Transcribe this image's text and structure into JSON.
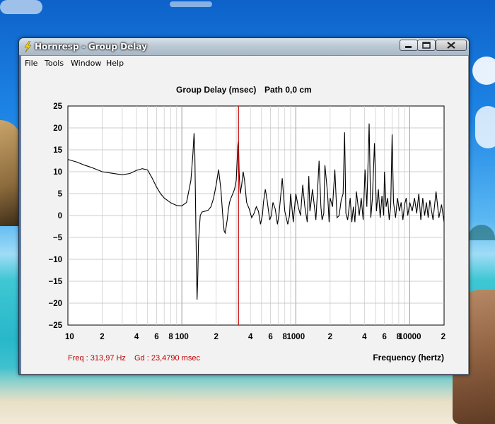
{
  "window": {
    "title": "Hornresp - Group Delay",
    "buttons": [
      "minimize",
      "maximize",
      "close"
    ]
  },
  "menu": {
    "file": "File",
    "tools": "Tools",
    "window": "Window",
    "help": "Help"
  },
  "colors": {
    "trace": "#000000",
    "cursor": "#c00000",
    "grid": "#bdbdbd",
    "background": "#ffffff"
  },
  "chart_data": {
    "type": "line",
    "title_left": "Group Delay (msec)",
    "title_right": "Path 0,0 cm",
    "xlabel": "Frequency (hertz)",
    "x_scale": "log",
    "xlim": [
      10,
      20000
    ],
    "ylim": [
      -25,
      25
    ],
    "grid": true,
    "y_ticks": [
      "25",
      "20",
      "15",
      "10",
      "5",
      "0",
      "−5",
      "−10",
      "−15",
      "−20",
      "−25"
    ],
    "x_tick_labels": [
      {
        "f": 10,
        "label": "10"
      },
      {
        "f": 20,
        "label": "2"
      },
      {
        "f": 40,
        "label": "4"
      },
      {
        "f": 60,
        "label": "6"
      },
      {
        "f": 80,
        "label": "8"
      },
      {
        "f": 100,
        "label": "100"
      },
      {
        "f": 200,
        "label": "2"
      },
      {
        "f": 400,
        "label": "4"
      },
      {
        "f": 600,
        "label": "6"
      },
      {
        "f": 800,
        "label": "8"
      },
      {
        "f": 1000,
        "label": "1000"
      },
      {
        "f": 2000,
        "label": "2"
      },
      {
        "f": 4000,
        "label": "4"
      },
      {
        "f": 6000,
        "label": "6"
      },
      {
        "f": 8000,
        "label": "8"
      },
      {
        "f": 10000,
        "label": "10000"
      },
      {
        "f": 20000,
        "label": "2"
      }
    ],
    "cursor": {
      "freq": 313.97,
      "gd": 23.479
    },
    "readout_freq": "Freq : 313,97 Hz",
    "readout_gd": "Gd : 23,4790 msec",
    "series": [
      {
        "x": [
          10,
          12,
          14,
          16,
          20,
          25,
          30,
          35,
          40,
          45,
          50,
          55,
          60,
          65,
          70,
          80,
          90,
          100,
          110,
          120,
          125,
          128,
          130,
          132,
          134,
          136,
          138,
          140,
          145,
          150,
          160,
          170,
          180,
          190,
          200,
          210,
          220,
          230,
          235,
          240,
          245,
          250,
          255,
          262,
          270,
          280,
          290,
          300,
          305,
          310,
          313.97,
          318,
          325,
          335,
          345,
          355,
          370,
          390,
          410,
          430,
          450,
          470,
          490,
          510,
          520,
          540,
          560,
          590,
          610,
          630,
          660,
          690,
          710,
          740,
          760,
          800,
          850,
          880,
          900,
          950,
          1000,
          1050,
          1100,
          1150,
          1200,
          1260,
          1300,
          1330,
          1360,
          1400,
          1500,
          1550,
          1600,
          1660,
          1700,
          1760,
          1800,
          1900,
          1960,
          2000,
          2100,
          2200,
          2300,
          2400,
          2500,
          2600,
          2680,
          2750,
          2850,
          3000,
          3100,
          3200,
          3300,
          3400,
          3600,
          3750,
          3900,
          4050,
          4200,
          4400,
          4550,
          4700,
          4900,
          5100,
          5300,
          5500,
          5700,
          5900,
          6000,
          6200,
          6400,
          6600,
          6800,
          7000,
          7200,
          7500,
          7800,
          8100,
          8400,
          8700,
          9000,
          9300,
          9600,
          10000,
          10500,
          11000,
          11500,
          12000,
          12500,
          13000,
          13500,
          14000,
          14500,
          15000,
          16000,
          17000,
          18000,
          19000,
          20000
        ],
        "y": [
          12.8,
          12.2,
          11.5,
          11,
          10,
          9.6,
          9.3,
          9.6,
          10.3,
          10.7,
          10.4,
          8.5,
          6.5,
          5,
          4,
          2.9,
          2.3,
          2.2,
          3,
          8,
          14,
          18.8,
          14,
          2,
          -10,
          -19.2,
          -14,
          -6,
          0,
          0.8,
          1,
          1.2,
          2,
          4,
          7,
          10.5,
          6,
          -1,
          -3.5,
          -4,
          -2.5,
          -1,
          1,
          3,
          4,
          5,
          6,
          8,
          12,
          16,
          17,
          10,
          5,
          7,
          10,
          8,
          3,
          1.5,
          -0.5,
          0.5,
          2,
          1,
          -2,
          0.2,
          3,
          6,
          3.5,
          -1,
          0,
          3,
          1.5,
          -2,
          0,
          5,
          8.5,
          1,
          -2,
          0,
          5,
          -1.5,
          5,
          2,
          0,
          7,
          2,
          -1.5,
          9,
          1,
          3,
          6,
          -1,
          5.5,
          12.5,
          2,
          -1,
          0.5,
          11.5,
          5,
          -1.5,
          4,
          2,
          10.5,
          -0.5,
          0,
          3.5,
          5,
          19,
          0.5,
          -1,
          4,
          -1.5,
          2,
          -1.5,
          5.5,
          0,
          4,
          -1,
          10.5,
          2,
          21,
          -0.5,
          4,
          16.5,
          1,
          6,
          -0.5,
          4.5,
          0,
          10,
          2,
          4,
          -1,
          2,
          18.5,
          3,
          -0.5,
          4,
          1,
          3,
          -1,
          2.5,
          4,
          0,
          3,
          1,
          4,
          0.5,
          5,
          -1,
          4,
          0,
          3,
          -0.5,
          3.5,
          -1,
          5.5,
          -0.5,
          2.5,
          -1.5
        ]
      }
    ]
  }
}
